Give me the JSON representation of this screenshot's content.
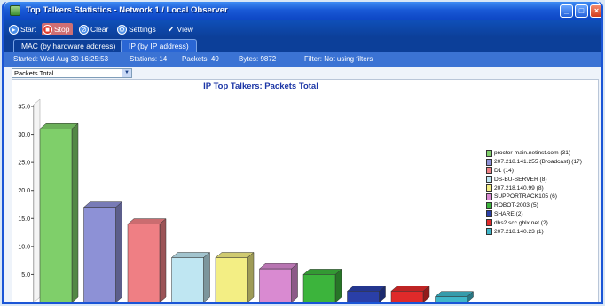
{
  "window": {
    "title": "Top Talkers Statistics - Network 1 / Local Observer"
  },
  "toolbar": {
    "start": "Start",
    "stop": "Stop",
    "clear": "Clear",
    "settings": "Settings",
    "view": "View"
  },
  "tabs": [
    "MAC (by hardware address)",
    "IP (by IP address)"
  ],
  "status": {
    "started": "Started: Wed Aug 30 16:25:53",
    "stations": "Stations: 14",
    "packets": "Packets: 49",
    "bytes": "Bytes: 9872",
    "filter": "Filter: Not using filters"
  },
  "metric_select": {
    "value": "Packets Total"
  },
  "chart_data": {
    "type": "bar",
    "title": "IP Top Talkers: Packets Total",
    "xlabel": "",
    "ylabel": "",
    "ylim": [
      0,
      35
    ],
    "yticks": [
      "35.0",
      "30.0",
      "25.0",
      "20.0",
      "15.0",
      "10.0",
      "5.0"
    ],
    "grid": false,
    "legend_position": "right",
    "categories": [
      "proctor-main.netinst.com",
      "207.218.141.255 (Broadcast)",
      "D1",
      "DS-BU-SERVER",
      "207.218.140.99",
      "SUPPORTRACK105",
      "ROBOT-2003",
      "SHARE",
      "dhs2.scc.gblx.net",
      "207.218.140.23"
    ],
    "legend_labels": [
      "proctor-main.netinst.com  (31)",
      "207.218.141.255 (Broadcast)  (17)",
      "D1  (14)",
      "DS-BU-SERVER  (8)",
      "207.218.140.99  (8)",
      "SUPPORTRACK105  (6)",
      "ROBOT-2003  (5)",
      "SHARE  (2)",
      "dhs2.scc.gblx.net  (2)",
      "207.218.140.23  (1)"
    ],
    "values": [
      31,
      17,
      14,
      8,
      8,
      6,
      5,
      2,
      2,
      1
    ],
    "colors": [
      "#7fcf6a",
      "#8d91d6",
      "#ef7f84",
      "#bfe6f2",
      "#f3ee84",
      "#d98ad1",
      "#3cb43c",
      "#2a3fa8",
      "#e02a2a",
      "#3fb6c9"
    ]
  }
}
